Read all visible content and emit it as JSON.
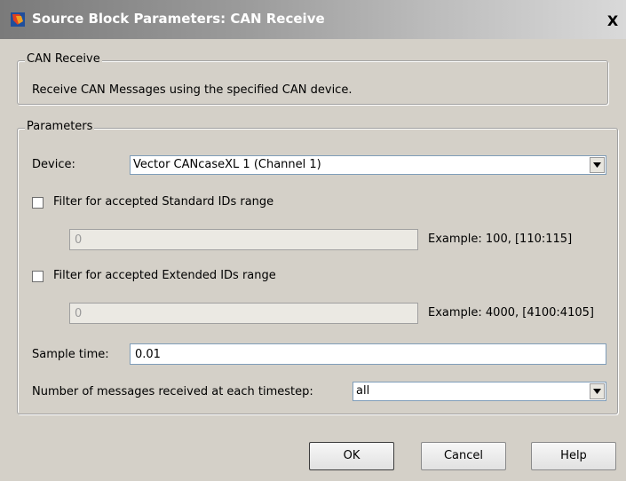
{
  "window": {
    "title": "Source Block Parameters: CAN Receive",
    "close_label": "X"
  },
  "description_group": {
    "legend": "CAN Receive",
    "text": "Receive CAN Messages using the specified CAN device."
  },
  "parameters_group": {
    "legend": "Parameters",
    "device": {
      "label": "Device:",
      "value": "Vector CANcaseXL 1 (Channel 1)"
    },
    "standard_filter": {
      "label": "Filter for accepted Standard IDs range",
      "checked": false,
      "value": "0",
      "example": "Example: 100, [110:115]"
    },
    "extended_filter": {
      "label": "Filter for accepted Extended IDs range",
      "checked": false,
      "value": "0",
      "example": "Example: 4000, [4100:4105]"
    },
    "sample_time": {
      "label": "Sample time:",
      "value": "0.01"
    },
    "messages_per_timestep": {
      "label": "Number of messages received at each timestep:",
      "value": "all"
    }
  },
  "buttons": {
    "ok": "OK",
    "cancel": "Cancel",
    "help": "Help"
  }
}
